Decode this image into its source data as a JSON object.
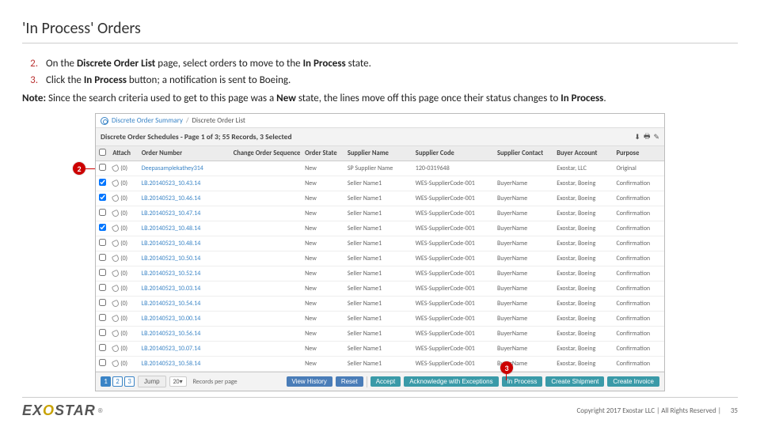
{
  "title": "'In Process' Orders",
  "steps": [
    {
      "num": "2.",
      "parts": [
        "On the ",
        "Discrete Order List",
        " page, select orders to move to the ",
        "In Process",
        " state."
      ]
    },
    {
      "num": "3.",
      "parts": [
        "Click the ",
        "In Process",
        "  button; a notification is sent to Boeing."
      ]
    }
  ],
  "note": {
    "label": "Note:",
    "text": " Since the search criteria used to get to this page was a ",
    "bold1": "New",
    "text2": " state, the lines move off this page once their status changes to ",
    "bold2": "In Process",
    "text3": "."
  },
  "breadcrumb": {
    "link": "Discrete Order Summary",
    "sep": "/",
    "current": "Discrete Order List"
  },
  "page_header": "Discrete Order Schedules - Page 1 of 3; 55 Records, 3 Selected",
  "columns": [
    "",
    "Attach",
    "Order Number",
    "Change Order Sequence",
    "Order State",
    "Supplier Name",
    "Supplier Code",
    "Supplier Contact",
    "Buyer Account",
    "Purpose"
  ],
  "rows": [
    {
      "chk": false,
      "att": "(0)",
      "order": "Deepasamplekathey314",
      "seq": "",
      "state": "New",
      "supp": "SP Supplier Name",
      "code": "120-0319648",
      "contact": "",
      "buyer": "Exostar, LLC",
      "purp": "Original"
    },
    {
      "chk": true,
      "att": "(0)",
      "order": "LB.20140523_10.43.14",
      "seq": "",
      "state": "New",
      "supp": "Seller Name1",
      "code": "WES-SupplierCode-001",
      "contact": "BuyerName",
      "buyer": "Exostar, Boeing",
      "purp": "Confirmation"
    },
    {
      "chk": true,
      "att": "(0)",
      "order": "LB.20140523_10.46.14",
      "seq": "",
      "state": "New",
      "supp": "Seller Name1",
      "code": "WES-SupplierCode-001",
      "contact": "BuyerName",
      "buyer": "Exostar, Boeing",
      "purp": "Confirmation"
    },
    {
      "chk": false,
      "att": "(0)",
      "order": "LB.20140523_10.47.14",
      "seq": "",
      "state": "New",
      "supp": "Seller Name1",
      "code": "WES-SupplierCode-001",
      "contact": "BuyerName",
      "buyer": "Exostar, Boeing",
      "purp": "Confirmation"
    },
    {
      "chk": true,
      "att": "(0)",
      "order": "LB.20140523_10.48.14",
      "seq": "",
      "state": "New",
      "supp": "Seller Name1",
      "code": "WES-SupplierCode-001",
      "contact": "BuyerName",
      "buyer": "Exostar, Boeing",
      "purp": "Confirmation"
    },
    {
      "chk": false,
      "att": "(0)",
      "order": "LB.20140523_10.48.14",
      "seq": "",
      "state": "New",
      "supp": "Seller Name1",
      "code": "WES-SupplierCode-001",
      "contact": "BuyerName",
      "buyer": "Exostar, Boeing",
      "purp": "Confirmation"
    },
    {
      "chk": false,
      "att": "(0)",
      "order": "LB.20140523_10.50.14",
      "seq": "",
      "state": "New",
      "supp": "Seller Name1",
      "code": "WES-SupplierCode-001",
      "contact": "BuyerName",
      "buyer": "Exostar, Boeing",
      "purp": "Confirmation"
    },
    {
      "chk": false,
      "att": "(0)",
      "order": "LB.20140523_10.52.14",
      "seq": "",
      "state": "New",
      "supp": "Seller Name1",
      "code": "WES-SupplierCode-001",
      "contact": "BuyerName",
      "buyer": "Exostar, Boeing",
      "purp": "Confirmation"
    },
    {
      "chk": false,
      "att": "(0)",
      "order": "LB.20140523_10.03.14",
      "seq": "",
      "state": "New",
      "supp": "Seller Name1",
      "code": "WES-SupplierCode-001",
      "contact": "BuyerName",
      "buyer": "Exostar, Boeing",
      "purp": "Confirmation"
    },
    {
      "chk": false,
      "att": "(0)",
      "order": "LB.20140523_10.54.14",
      "seq": "",
      "state": "New",
      "supp": "Seller Name1",
      "code": "WES-SupplierCode-001",
      "contact": "BuyerName",
      "buyer": "Exostar, Boeing",
      "purp": "Confirmation"
    },
    {
      "chk": false,
      "att": "(0)",
      "order": "LB.20140523_10.00.14",
      "seq": "",
      "state": "New",
      "supp": "Seller Name1",
      "code": "WES-SupplierCode-001",
      "contact": "BuyerName",
      "buyer": "Exostar, Boeing",
      "purp": "Confirmation"
    },
    {
      "chk": false,
      "att": "(0)",
      "order": "LB.20140523_10.56.14",
      "seq": "",
      "state": "New",
      "supp": "Seller Name1",
      "code": "WES-SupplierCode-001",
      "contact": "BuyerName",
      "buyer": "Exostar, Boeing",
      "purp": "Confirmation"
    },
    {
      "chk": false,
      "att": "(0)",
      "order": "LB.20140523_10.07.14",
      "seq": "",
      "state": "New",
      "supp": "Seller Name1",
      "code": "WES-SupplierCode-001",
      "contact": "BuyerName",
      "buyer": "Exostar, Boeing",
      "purp": "Confirmation"
    },
    {
      "chk": false,
      "att": "(0)",
      "order": "LB.20140523_10.58.14",
      "seq": "",
      "state": "New",
      "supp": "Seller Name1",
      "code": "WES-SupplierCode-001",
      "contact": "BuyerName",
      "buyer": "Exostar, Boeing",
      "purp": "Confirmation"
    }
  ],
  "pager": {
    "pages": [
      "1",
      "2",
      "3"
    ],
    "perpage": "20",
    "rpp_label": "Records per page"
  },
  "actions": {
    "jump": "Jump",
    "viewhist": "View History",
    "reset": "Reset",
    "accept": "Accept",
    "awe": "Acknowledge with Exceptions",
    "inproc": "In Process",
    "cship": "Create Shipment",
    "cinv": "Create Invoice"
  },
  "callouts": {
    "c2": "2",
    "c3": "3"
  },
  "footer": {
    "logo_ex": "EX",
    "logo_o": "O",
    "logo_star": "STAR",
    "reg": "®",
    "copy": "Copyright 2017 Exostar LLC | All Rights Reserved |",
    "page": "35"
  }
}
